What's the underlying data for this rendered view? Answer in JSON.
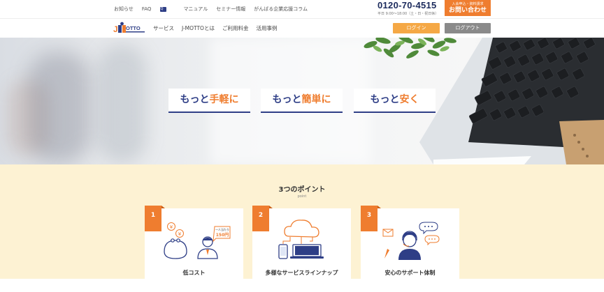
{
  "topbar": {
    "links": [
      "お知らせ",
      "FAQ",
      "マニュアル",
      "セミナー情報",
      "がんばる企業応援コラム"
    ],
    "faq_badge": "Q",
    "phone": "0120-70-4515",
    "hours": "平日 9:00～18:00（土・日・祝日休）",
    "contact_sub": "入会申込・資料請求",
    "contact_main": "お問い合わせ"
  },
  "mainnav": {
    "logo_alt": "J-MOTTO",
    "links": [
      "サービス",
      "J-MOTTOとは",
      "ご利用料金",
      "活用事例"
    ],
    "login_label": "ログイン",
    "logout_label": "ログアウト"
  },
  "hero": {
    "taglines": [
      {
        "prefix": "もっと",
        "highlight": "手軽に",
        "suffix": ""
      },
      {
        "prefix": "もっと",
        "highlight": "簡単に",
        "suffix": ""
      },
      {
        "prefix": "もっと",
        "highlight": "安く",
        "suffix": ""
      }
    ]
  },
  "points": {
    "title": "3つのポイント",
    "subtitle": "point",
    "cards": [
      {
        "number": "1",
        "label": "低コスト",
        "price_line1": "一人当たり",
        "price_line2": "150円",
        "icon": "wallet-coins-icon"
      },
      {
        "number": "2",
        "label": "多様なサービスラインナップ",
        "icon": "cloud-devices-icon"
      },
      {
        "number": "3",
        "label": "安心のサポート体制",
        "icon": "support-operator-icon"
      }
    ]
  },
  "colors": {
    "accent": "#ef7d2f",
    "navy": "#2e3e86",
    "section_bg": "#fdf2d3"
  }
}
